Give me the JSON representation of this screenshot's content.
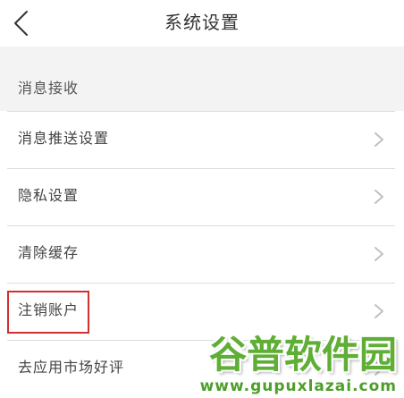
{
  "header": {
    "title": "系统设置",
    "back_icon": "chevron-left-icon"
  },
  "section": {
    "title": "消息接收"
  },
  "menu": {
    "row_icon": "chevron-right-icon",
    "items": [
      {
        "label": "消息推送设置"
      },
      {
        "label": "隐私设置"
      },
      {
        "label": "清除缓存"
      },
      {
        "label": "注销账户",
        "highlighted": true
      },
      {
        "label": "去应用市场好评"
      }
    ]
  },
  "watermark": {
    "logo_text": "谷普软件园",
    "url": "www.gupuxlazai.com"
  },
  "colors": {
    "title_text": "#333333",
    "row_text": "#444444",
    "section_background": "#f3f3f3",
    "divider": "#dcdcdc",
    "chevron": "#c0c0c0",
    "highlight": "#d0302f",
    "watermark_green": "#5fae36"
  }
}
